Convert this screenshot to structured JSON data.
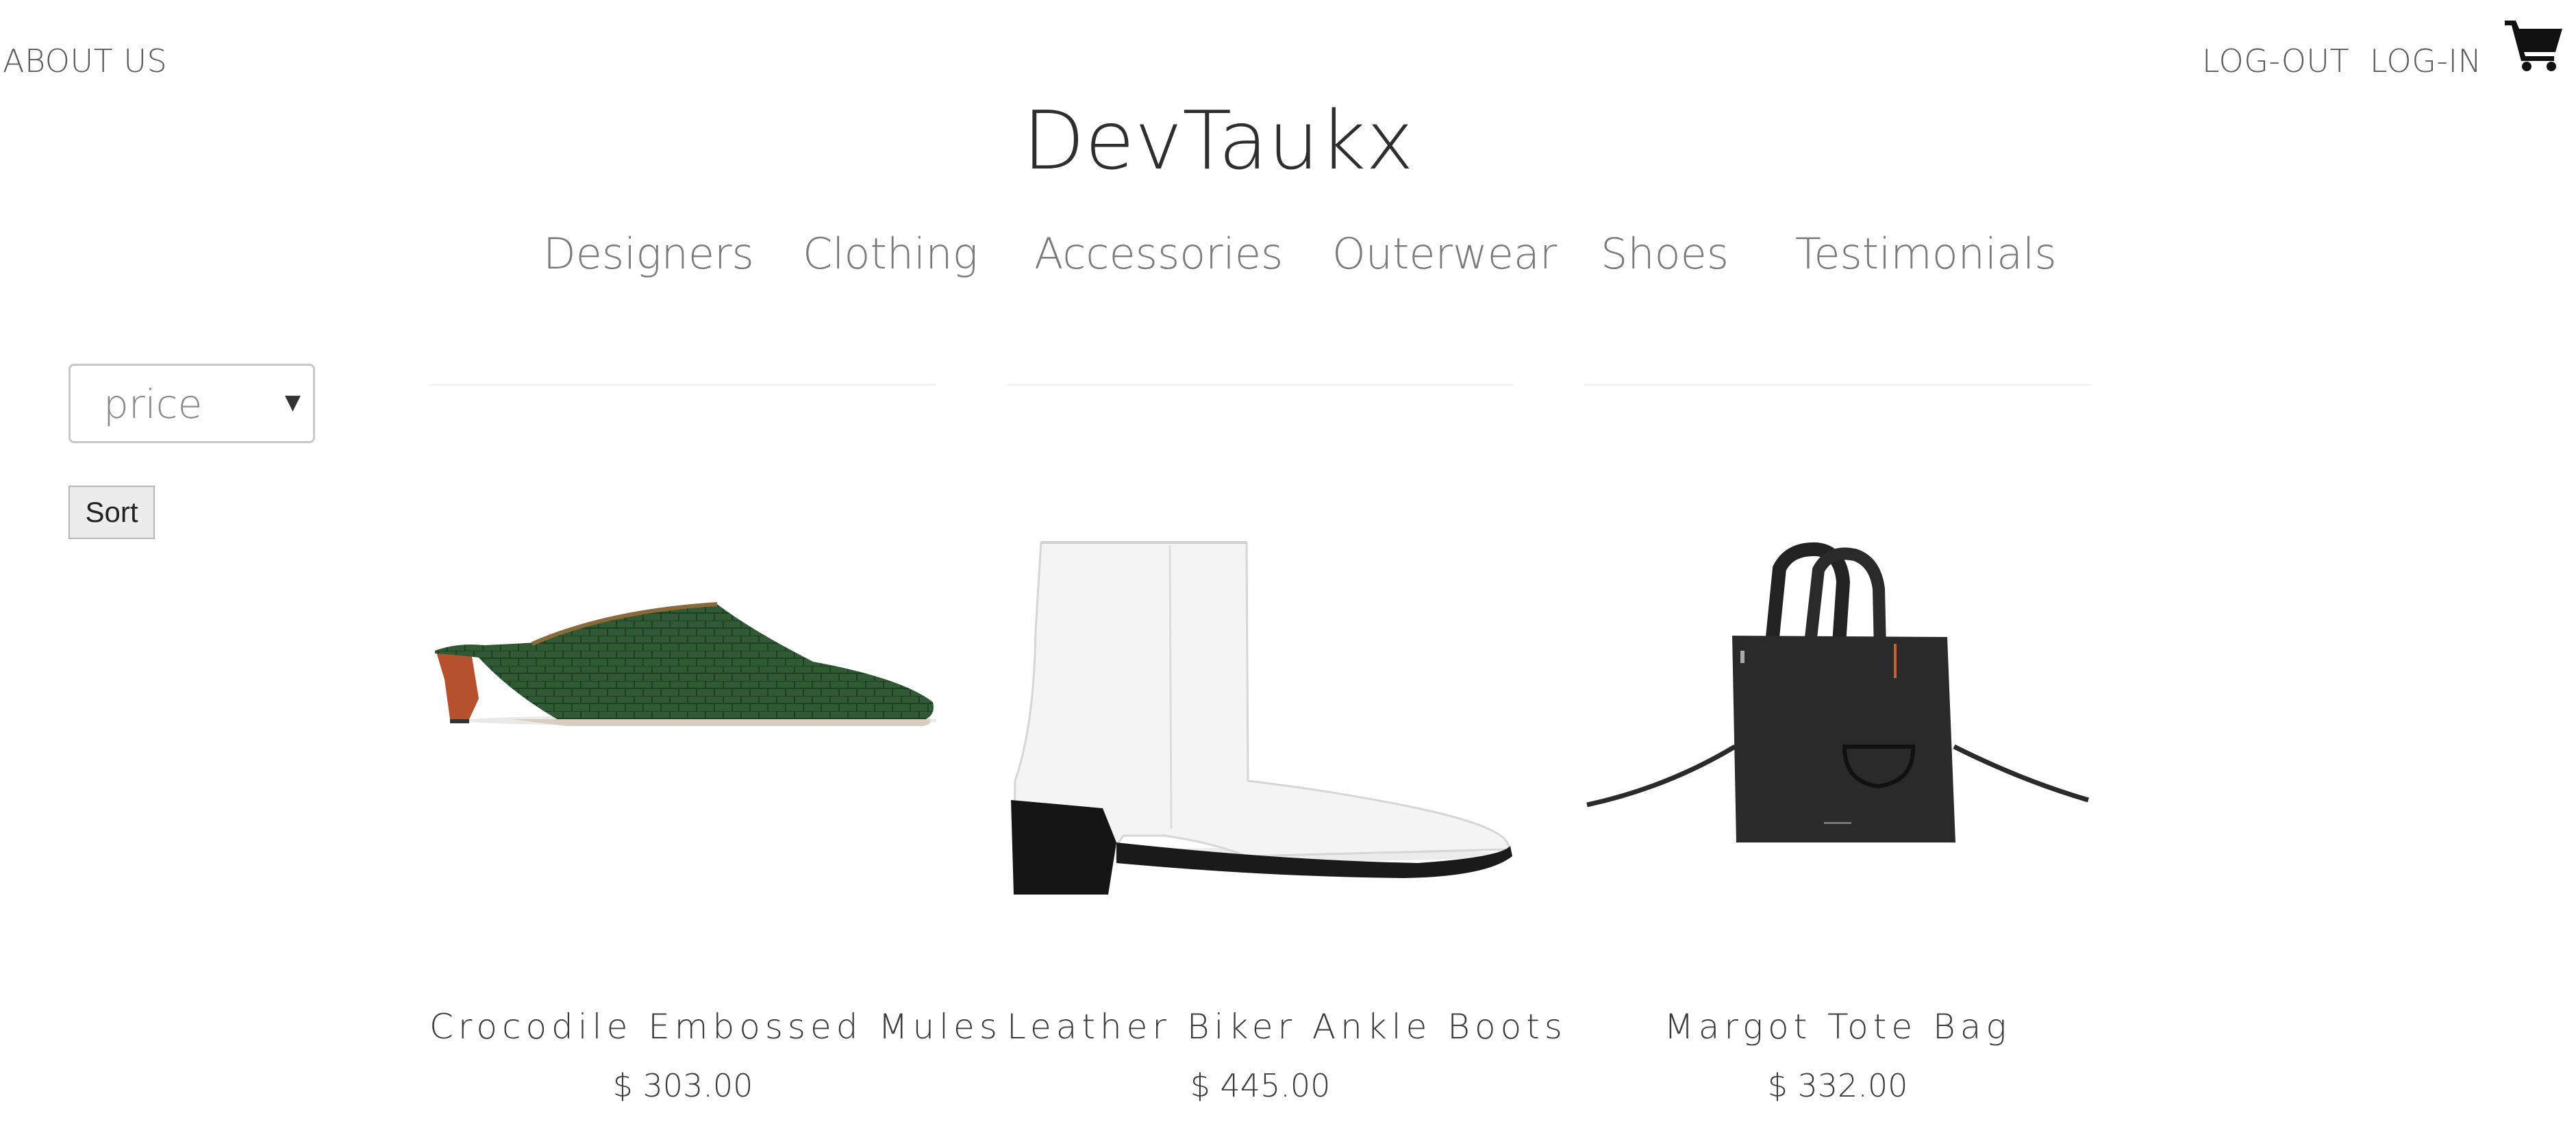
{
  "header": {
    "about_label": "ABOUT US",
    "logout_label": "LOG-OUT",
    "login_label": "LOG-IN",
    "cart_icon": "shopping-cart-icon",
    "brand": "DevTaukx"
  },
  "nav": {
    "items": [
      {
        "label": "Designers"
      },
      {
        "label": "Clothing"
      },
      {
        "label": "Accessories"
      },
      {
        "label": "Outerwear"
      },
      {
        "label": "Shoes"
      },
      {
        "label": "Testimonials"
      }
    ]
  },
  "sort": {
    "selected": "price",
    "button_label": "Sort"
  },
  "products": [
    {
      "name": "Crocodile Embossed Mules",
      "price": "$ 303.00",
      "image": "green-croc-mule-image"
    },
    {
      "name": "Leather Biker Ankle Boots",
      "price": "$ 445.00",
      "image": "white-ankle-boot-image"
    },
    {
      "name": "Margot Tote Bag",
      "price": "$ 332.00",
      "image": "black-tote-bag-image"
    }
  ],
  "colors": {
    "text": "#5a5a5a",
    "brand": "#2e2e2e",
    "mule_green": "#2f5a34",
    "mule_heel": "#b5512c",
    "bag_black": "#2a2a2a"
  }
}
